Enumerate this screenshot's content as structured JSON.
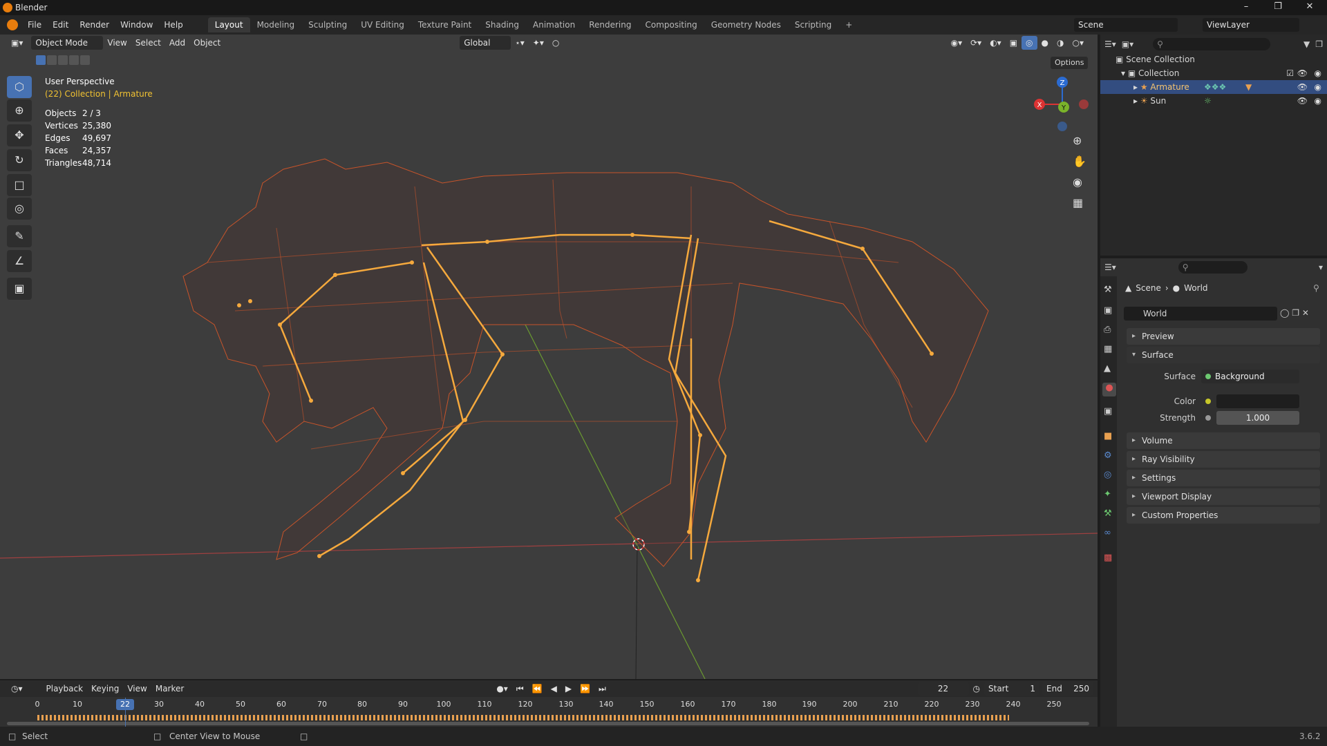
{
  "window": {
    "title": "Blender",
    "version": "3.6.2"
  },
  "menu": [
    "File",
    "Edit",
    "Render",
    "Window",
    "Help"
  ],
  "workspaces": [
    "Layout",
    "Modeling",
    "Sculpting",
    "UV Editing",
    "Texture Paint",
    "Shading",
    "Animation",
    "Rendering",
    "Compositing",
    "Geometry Nodes",
    "Scripting"
  ],
  "active_workspace": "Layout",
  "scene_name": "Scene",
  "view_layer": "ViewLayer",
  "viewport": {
    "mode": "Object Mode",
    "header_menus": [
      "View",
      "Select",
      "Add",
      "Object"
    ],
    "transform_orientation": "Global",
    "options_label": "Options",
    "perspective": "User Perspective",
    "context": "(22) Collection | Armature",
    "stats": [
      {
        "label": "Objects",
        "value": "2 / 3"
      },
      {
        "label": "Vertices",
        "value": "25,380"
      },
      {
        "label": "Edges",
        "value": "49,697"
      },
      {
        "label": "Faces",
        "value": "24,357"
      },
      {
        "label": "Triangles",
        "value": "48,714"
      }
    ],
    "gizmo_axes": {
      "x": "X",
      "y": "Y",
      "z": "Z"
    },
    "wire_color": "#c8542a",
    "bone_color": "#f5a93d"
  },
  "outliner": {
    "root": "Scene Collection",
    "collection": "Collection",
    "items": [
      {
        "name": "Armature",
        "selected": true
      },
      {
        "name": "Sun",
        "selected": false
      }
    ]
  },
  "properties": {
    "breadcrumb": [
      "Scene",
      "World"
    ],
    "datablock": "World",
    "panels": [
      "Preview",
      "Surface",
      "Volume",
      "Ray Visibility",
      "Settings",
      "Viewport Display",
      "Custom Properties"
    ],
    "surface": {
      "surface_label": "Surface",
      "surface_value": "Background",
      "color_label": "Color",
      "color_value": "#1e1e1e",
      "strength_label": "Strength",
      "strength_value": "1.000"
    }
  },
  "timeline": {
    "menus": [
      "Playback",
      "Keying",
      "View",
      "Marker"
    ],
    "current_frame": "22",
    "start_label": "Start",
    "start": "1",
    "end_label": "End",
    "end": "250",
    "ticks": [
      "0",
      "10",
      "20",
      "30",
      "40",
      "50",
      "60",
      "70",
      "80",
      "90",
      "100",
      "110",
      "120",
      "130",
      "140",
      "150",
      "160",
      "170",
      "180",
      "190",
      "200",
      "210",
      "220",
      "230",
      "240",
      "250"
    ]
  },
  "statusbar": {
    "select": "Select",
    "center_view": "Center View to Mouse",
    "version": "3.6.2"
  }
}
